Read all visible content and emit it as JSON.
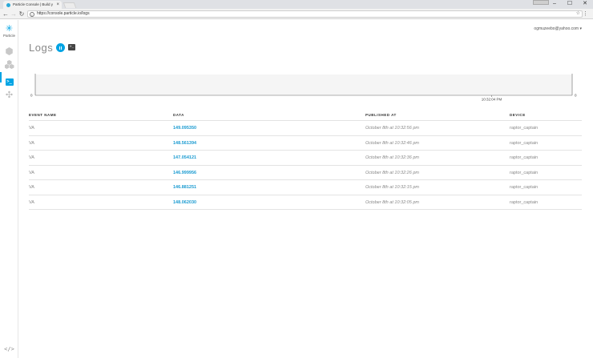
{
  "browser": {
    "tab_title": "Particle Console | Build y",
    "tab_close": "×",
    "url": "https://console.particle.io/logs",
    "info_glyph": "i",
    "win_min": "–",
    "win_max": "☐",
    "win_close": "✕",
    "menu": "⋮",
    "star": "☆"
  },
  "sidebar": {
    "logo_text": "Particle",
    "logs_glyph": ">_",
    "code_glyph": "</>"
  },
  "header": {
    "user_email": "ogmuzeebo@yahoo.com",
    "user_caret": "▾",
    "title": "Logs",
    "term_glyph": ">_"
  },
  "chart_data": {
    "type": "line",
    "y_left_tick": "0",
    "y_right_tick": "0",
    "x_tick": "10:32:04 PM",
    "x_tick_position": 0.85,
    "values": []
  },
  "table": {
    "headers": [
      "EVENT NAME",
      "DATA",
      "PUBLISHED AT",
      "DEVICE"
    ],
    "rows": [
      {
        "event": "VA",
        "data": "149.095350",
        "published": "October 8th at 10:32:56 pm",
        "device": "raptor_captain"
      },
      {
        "event": "VA",
        "data": "148.561394",
        "published": "October 8th at 10:32:46 pm",
        "device": "raptor_captain"
      },
      {
        "event": "VA",
        "data": "147.054121",
        "published": "October 8th at 10:32:36 pm",
        "device": "raptor_captain"
      },
      {
        "event": "VA",
        "data": "146.999956",
        "published": "October 8th at 10:32:26 pm",
        "device": "raptor_captain"
      },
      {
        "event": "VA",
        "data": "146.881251",
        "published": "October 8th at 10:32:15 pm",
        "device": "raptor_captain"
      },
      {
        "event": "VA",
        "data": "148.062030",
        "published": "October 8th at 10:32:05 pm",
        "device": "raptor_captain"
      }
    ]
  },
  "colors": {
    "accent": "#00a4e4",
    "data_link": "#1b9bd1"
  }
}
